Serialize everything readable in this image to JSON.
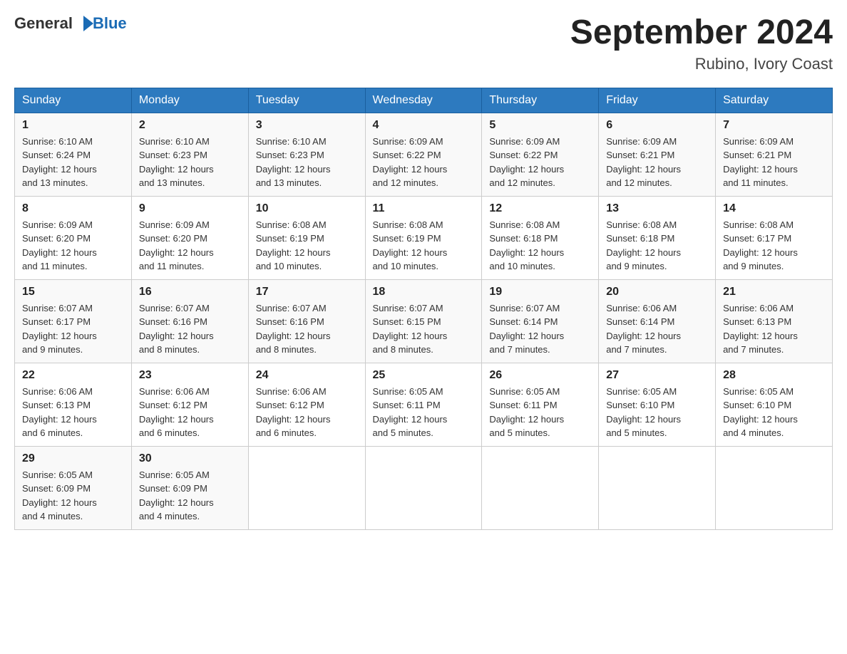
{
  "header": {
    "logo_general": "General",
    "logo_blue": "Blue",
    "main_title": "September 2024",
    "subtitle": "Rubino, Ivory Coast"
  },
  "days_of_week": [
    "Sunday",
    "Monday",
    "Tuesday",
    "Wednesday",
    "Thursday",
    "Friday",
    "Saturday"
  ],
  "weeks": [
    [
      {
        "day": "1",
        "sunrise": "6:10 AM",
        "sunset": "6:24 PM",
        "daylight": "12 hours and 13 minutes."
      },
      {
        "day": "2",
        "sunrise": "6:10 AM",
        "sunset": "6:23 PM",
        "daylight": "12 hours and 13 minutes."
      },
      {
        "day": "3",
        "sunrise": "6:10 AM",
        "sunset": "6:23 PM",
        "daylight": "12 hours and 13 minutes."
      },
      {
        "day": "4",
        "sunrise": "6:09 AM",
        "sunset": "6:22 PM",
        "daylight": "12 hours and 12 minutes."
      },
      {
        "day": "5",
        "sunrise": "6:09 AM",
        "sunset": "6:22 PM",
        "daylight": "12 hours and 12 minutes."
      },
      {
        "day": "6",
        "sunrise": "6:09 AM",
        "sunset": "6:21 PM",
        "daylight": "12 hours and 12 minutes."
      },
      {
        "day": "7",
        "sunrise": "6:09 AM",
        "sunset": "6:21 PM",
        "daylight": "12 hours and 11 minutes."
      }
    ],
    [
      {
        "day": "8",
        "sunrise": "6:09 AM",
        "sunset": "6:20 PM",
        "daylight": "12 hours and 11 minutes."
      },
      {
        "day": "9",
        "sunrise": "6:09 AM",
        "sunset": "6:20 PM",
        "daylight": "12 hours and 11 minutes."
      },
      {
        "day": "10",
        "sunrise": "6:08 AM",
        "sunset": "6:19 PM",
        "daylight": "12 hours and 10 minutes."
      },
      {
        "day": "11",
        "sunrise": "6:08 AM",
        "sunset": "6:19 PM",
        "daylight": "12 hours and 10 minutes."
      },
      {
        "day": "12",
        "sunrise": "6:08 AM",
        "sunset": "6:18 PM",
        "daylight": "12 hours and 10 minutes."
      },
      {
        "day": "13",
        "sunrise": "6:08 AM",
        "sunset": "6:18 PM",
        "daylight": "12 hours and 9 minutes."
      },
      {
        "day": "14",
        "sunrise": "6:08 AM",
        "sunset": "6:17 PM",
        "daylight": "12 hours and 9 minutes."
      }
    ],
    [
      {
        "day": "15",
        "sunrise": "6:07 AM",
        "sunset": "6:17 PM",
        "daylight": "12 hours and 9 minutes."
      },
      {
        "day": "16",
        "sunrise": "6:07 AM",
        "sunset": "6:16 PM",
        "daylight": "12 hours and 8 minutes."
      },
      {
        "day": "17",
        "sunrise": "6:07 AM",
        "sunset": "6:16 PM",
        "daylight": "12 hours and 8 minutes."
      },
      {
        "day": "18",
        "sunrise": "6:07 AM",
        "sunset": "6:15 PM",
        "daylight": "12 hours and 8 minutes."
      },
      {
        "day": "19",
        "sunrise": "6:07 AM",
        "sunset": "6:14 PM",
        "daylight": "12 hours and 7 minutes."
      },
      {
        "day": "20",
        "sunrise": "6:06 AM",
        "sunset": "6:14 PM",
        "daylight": "12 hours and 7 minutes."
      },
      {
        "day": "21",
        "sunrise": "6:06 AM",
        "sunset": "6:13 PM",
        "daylight": "12 hours and 7 minutes."
      }
    ],
    [
      {
        "day": "22",
        "sunrise": "6:06 AM",
        "sunset": "6:13 PM",
        "daylight": "12 hours and 6 minutes."
      },
      {
        "day": "23",
        "sunrise": "6:06 AM",
        "sunset": "6:12 PM",
        "daylight": "12 hours and 6 minutes."
      },
      {
        "day": "24",
        "sunrise": "6:06 AM",
        "sunset": "6:12 PM",
        "daylight": "12 hours and 6 minutes."
      },
      {
        "day": "25",
        "sunrise": "6:05 AM",
        "sunset": "6:11 PM",
        "daylight": "12 hours and 5 minutes."
      },
      {
        "day": "26",
        "sunrise": "6:05 AM",
        "sunset": "6:11 PM",
        "daylight": "12 hours and 5 minutes."
      },
      {
        "day": "27",
        "sunrise": "6:05 AM",
        "sunset": "6:10 PM",
        "daylight": "12 hours and 5 minutes."
      },
      {
        "day": "28",
        "sunrise": "6:05 AM",
        "sunset": "6:10 PM",
        "daylight": "12 hours and 4 minutes."
      }
    ],
    [
      {
        "day": "29",
        "sunrise": "6:05 AM",
        "sunset": "6:09 PM",
        "daylight": "12 hours and 4 minutes."
      },
      {
        "day": "30",
        "sunrise": "6:05 AM",
        "sunset": "6:09 PM",
        "daylight": "12 hours and 4 minutes."
      },
      null,
      null,
      null,
      null,
      null
    ]
  ]
}
